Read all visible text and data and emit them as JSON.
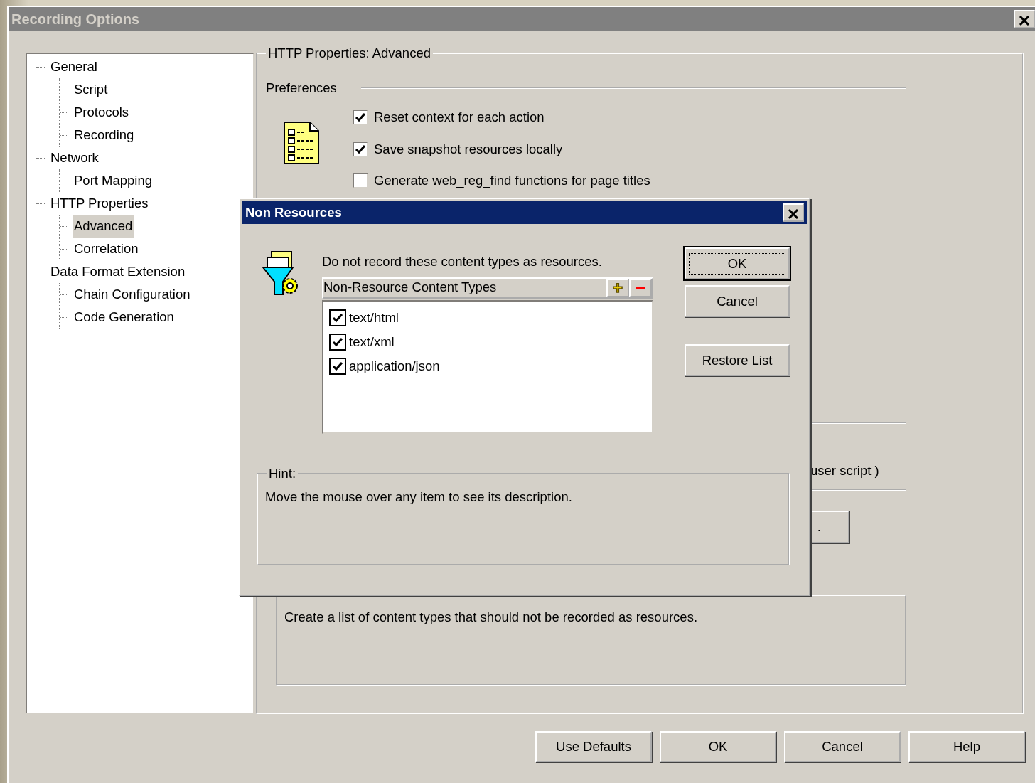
{
  "window": {
    "title": "Recording Options"
  },
  "tree": [
    {
      "label": "General",
      "selected": false,
      "children": [
        {
          "label": "Script",
          "selected": false
        },
        {
          "label": "Protocols",
          "selected": false
        },
        {
          "label": "Recording",
          "selected": false
        }
      ]
    },
    {
      "label": "Network",
      "selected": false,
      "children": [
        {
          "label": "Port Mapping",
          "selected": false
        }
      ]
    },
    {
      "label": "HTTP Properties",
      "selected": false,
      "children": [
        {
          "label": "Advanced",
          "selected": true
        },
        {
          "label": "Correlation",
          "selected": false
        }
      ]
    },
    {
      "label": "Data Format Extension",
      "selected": false,
      "children": [
        {
          "label": "Chain Configuration",
          "selected": false
        },
        {
          "label": "Code Generation",
          "selected": false
        }
      ]
    }
  ],
  "panel": {
    "title": "HTTP Properties: Advanced",
    "section": "Preferences",
    "options": [
      {
        "label": "Reset context for each action",
        "checked": true
      },
      {
        "label": "Save snapshot resources locally",
        "checked": true
      },
      {
        "label": "Generate web_reg_find functions for page titles",
        "checked": false
      }
    ],
    "fragment_text": "user script )",
    "button_fragment": ".",
    "description": {
      "text": "Create a list of content types that should not be recorded as resources."
    }
  },
  "dialog": {
    "title": "Non Resources",
    "message": "Do not record these content types as resources.",
    "list_header": "Non-Resource Content Types",
    "add_symbol": "+",
    "remove_symbol": "−",
    "items": [
      {
        "label": "text/html",
        "checked": true
      },
      {
        "label": "text/xml",
        "checked": true
      },
      {
        "label": "application/json",
        "checked": true
      }
    ],
    "buttons": [
      {
        "label": "OK",
        "default": true
      },
      {
        "label": "Cancel",
        "default": false
      },
      {
        "label": "Restore List",
        "default": false
      }
    ],
    "hint": {
      "title": "Hint:",
      "text": "Move the mouse over any item to see its description."
    }
  },
  "buttons": [
    "Use Defaults",
    "OK",
    "Cancel",
    "Help"
  ]
}
